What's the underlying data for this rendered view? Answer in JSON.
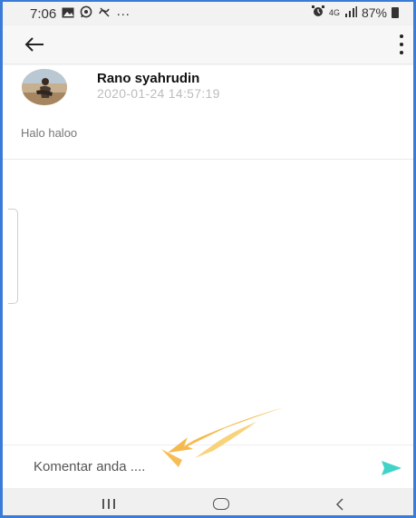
{
  "status_bar": {
    "time": "7:06",
    "left_icons": [
      "gallery-icon",
      "whatsapp-icon",
      "muted-icon",
      "more-notifications-icon"
    ],
    "more": "···",
    "network": "4G",
    "battery": "87%",
    "right_icons": [
      "alarm-icon",
      "network-4g-icon",
      "signal-icon",
      "battery-icon"
    ]
  },
  "app_bar": {
    "back_icon": "arrow-left-icon",
    "menu_icon": "more-vert-icon"
  },
  "post": {
    "author": "Rano syahrudin",
    "timestamp": "2020-01-24 14:57:19",
    "body": "Halo haloo"
  },
  "comment": {
    "placeholder": "Komentar anda ....",
    "value": "",
    "send_icon": "send-icon",
    "send_color": "#40d3c8"
  },
  "nav_bar": {
    "recents_icon": "recents-icon",
    "home_icon": "home-icon",
    "back_icon": "nav-back-icon"
  },
  "colors": {
    "frame_border": "#3b7bd8",
    "annotation_arrow": "#f4b23a"
  }
}
